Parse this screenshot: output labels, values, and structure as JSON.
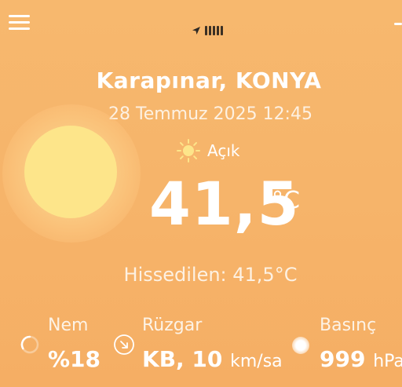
{
  "header": {
    "menu_icon": "hamburger-menu-icon",
    "status_icon": "navigation-arrow-icon"
  },
  "location": "Karapınar, KONYA",
  "datetime": "28 Temmuz 2025 12:45",
  "weather": {
    "icon": "sun-icon",
    "condition": "Açık",
    "temperature": "41,5",
    "unit": "°C",
    "feels_like": "Hissedilen: 41,5°C"
  },
  "stats": {
    "humidity": {
      "label": "Nem",
      "value": "%18",
      "icon": "humidity-ring-icon"
    },
    "wind": {
      "label": "Rüzgar",
      "value": "KB, 10",
      "unit": "km/sa",
      "icon": "wind-direction-icon"
    },
    "pressure": {
      "label": "Basınç",
      "value": "999",
      "unit": "hPa",
      "icon": "pressure-glow-icon"
    }
  },
  "colors": {
    "background": "#f6b46a",
    "sun": "#fde58a",
    "text": "#ffffff"
  }
}
